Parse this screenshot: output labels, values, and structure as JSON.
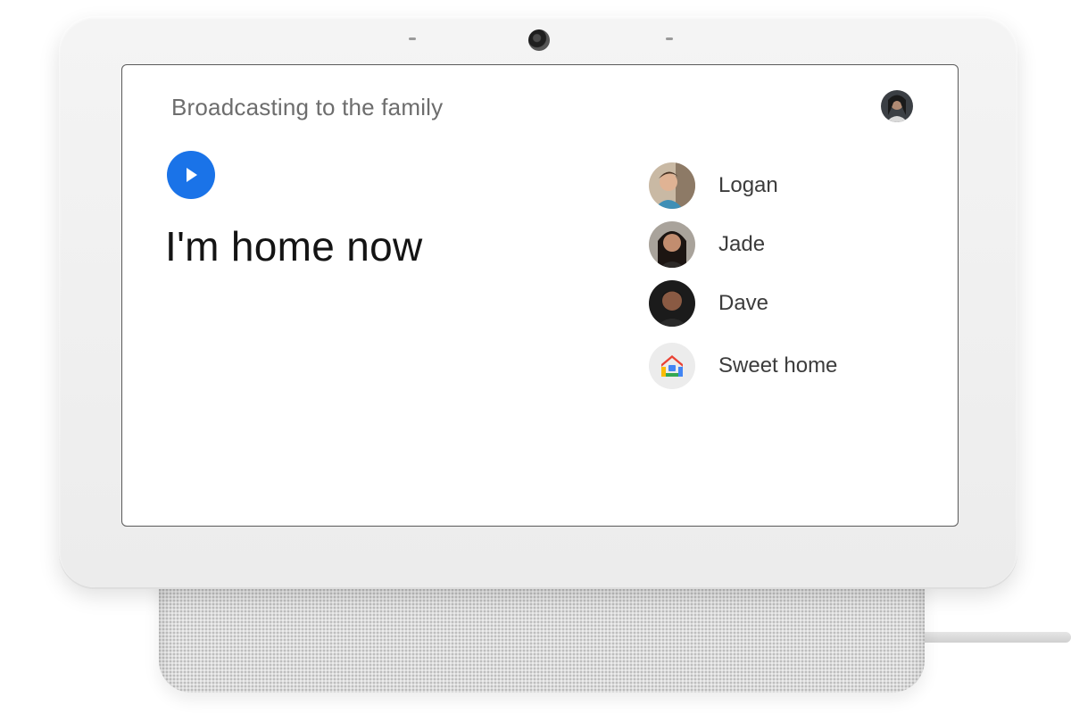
{
  "screen": {
    "title": "Broadcasting to the family",
    "message": "I'm home now",
    "play_icon": "play-icon",
    "accent_color": "#1a73e8"
  },
  "recipients": [
    {
      "name": "Logan",
      "avatar": "person-photo"
    },
    {
      "name": "Jade",
      "avatar": "person-photo"
    },
    {
      "name": "Dave",
      "avatar": "person-photo"
    },
    {
      "name": "Sweet home",
      "avatar": "google-home-icon"
    }
  ],
  "colors": {
    "home_red": "#ea4335",
    "home_yellow": "#fbbc04",
    "home_green": "#34a853",
    "home_blue": "#4285f4"
  }
}
